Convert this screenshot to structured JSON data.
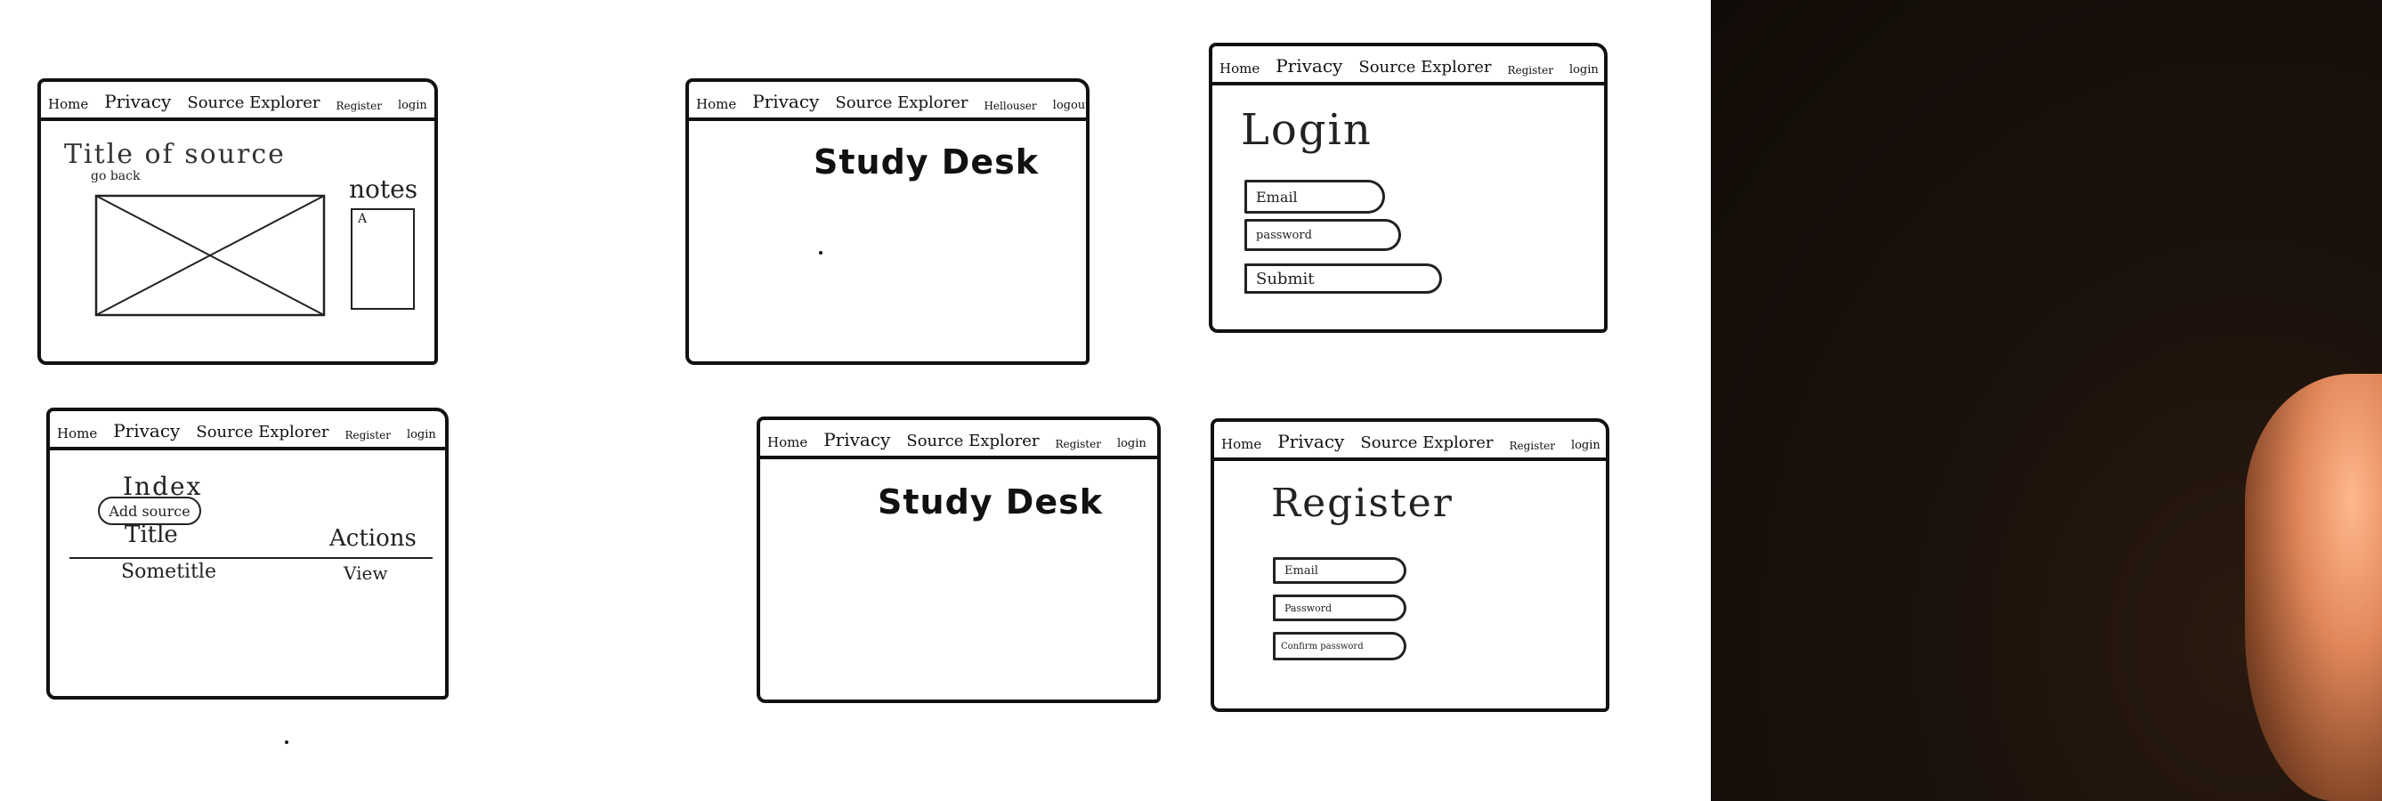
{
  "nav": {
    "home": "Home",
    "privacy": "Privacy",
    "source_explorer": "Source Explorer",
    "register": "Register",
    "login": "login",
    "hello_user": "Hellouser",
    "logout": "logout"
  },
  "sketch_source": {
    "title": "Title of source",
    "go_back": "go back",
    "notes": "notes",
    "notes_marker": "A"
  },
  "sketch_home_logged_in": {
    "heading": "Study Desk"
  },
  "sketch_login": {
    "heading": "Login",
    "email": "Email",
    "password": "password",
    "submit": "Submit"
  },
  "sketch_index": {
    "heading": "Index",
    "add_button": "Add source",
    "col_title": "Title",
    "col_actions": "Actions",
    "row_title": "Sometitle",
    "row_action": "View"
  },
  "sketch_home": {
    "heading": "Study Desk"
  },
  "sketch_register": {
    "heading": "Register",
    "email": "Email",
    "password": "Password",
    "confirm_password": "Confirm password"
  },
  "colors": {
    "ink": "#111111",
    "paper": "#ffffff",
    "dark_background": "#1a110b",
    "skin": "#e0875a"
  }
}
